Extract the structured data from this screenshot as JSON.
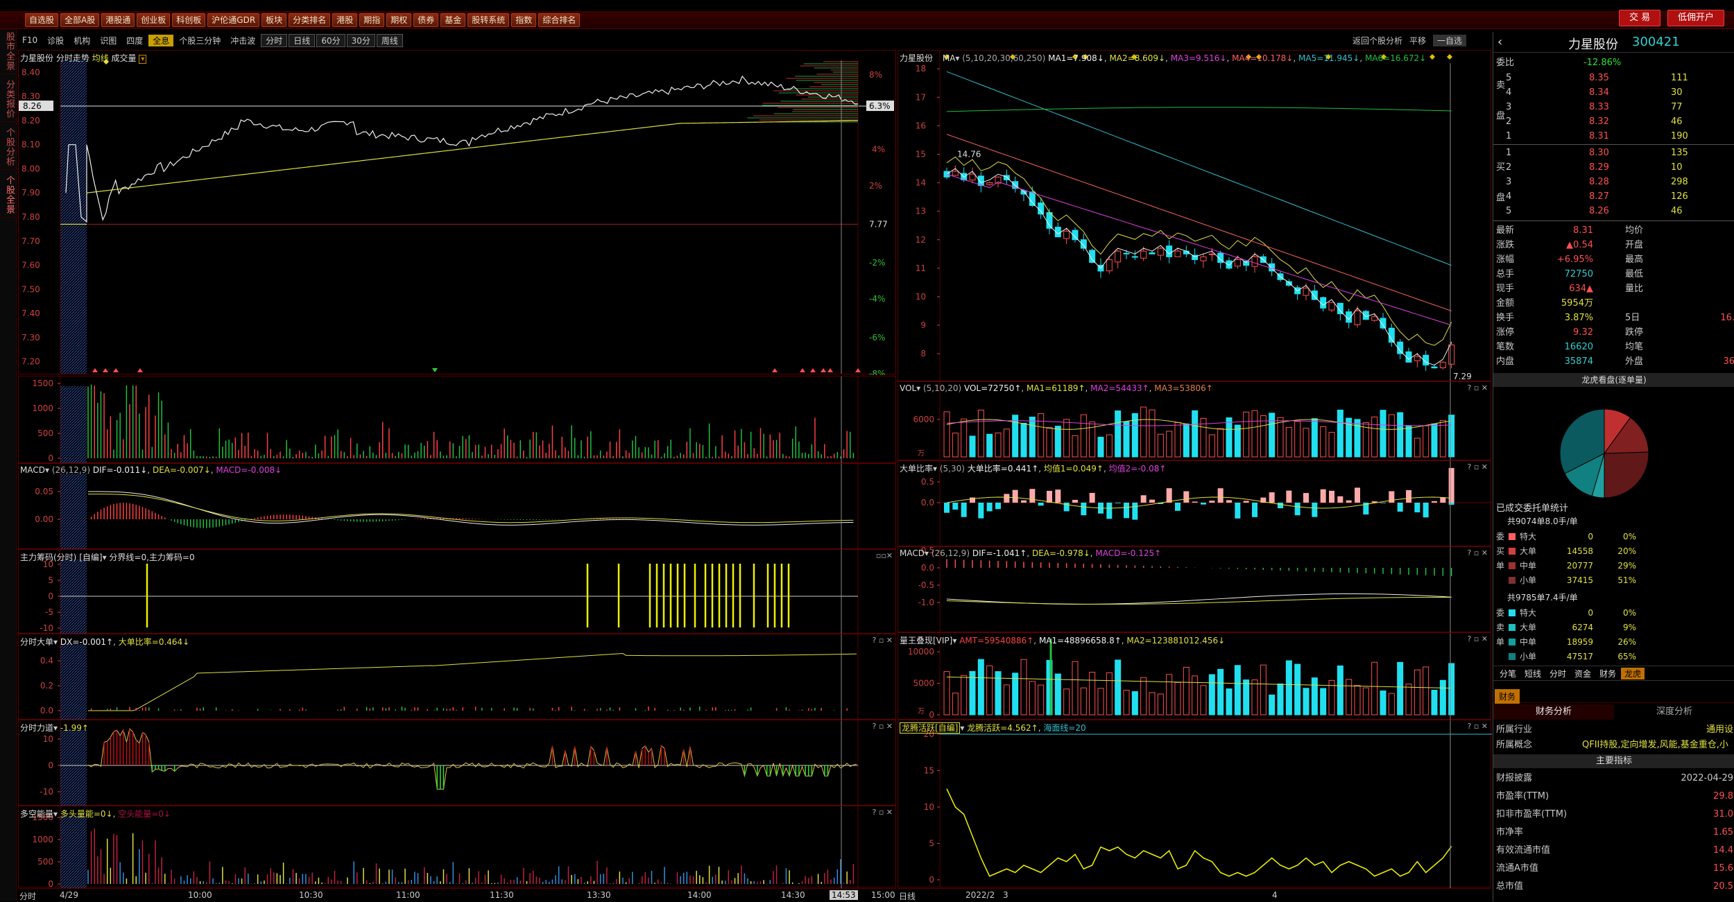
{
  "topbar": {
    "text": ""
  },
  "toolbar": {
    "items": [
      "自选股",
      "全部A股",
      "港股通",
      "创业板",
      "科创板",
      "沪伦通GDR",
      "板块",
      "分类排名",
      "港股",
      "期指",
      "期权",
      "债券",
      "基金",
      "股转系统",
      "指数",
      "综合排名"
    ],
    "trade": "交 易",
    "margin": "低佣开户"
  },
  "vtabs": [
    "股市全景",
    "分类报价",
    "个股分析",
    "个股全景"
  ],
  "subbar": {
    "items": [
      "F10",
      "诊股",
      "机构",
      "识图",
      "四度",
      "全息",
      "个股三分钟",
      "冲击波",
      "分时",
      "日线",
      "60分",
      "30分",
      "周线"
    ],
    "active": "全息",
    "right": [
      "返回个股分析",
      "平移",
      "一自选"
    ]
  },
  "intraday": {
    "title": "力星股份",
    "title2": "分时走势",
    "title3": "均线",
    "title4": "成交量",
    "y_left": [
      "8.40",
      "8.30",
      "8.26",
      "8.20",
      "8.10",
      "8.00",
      "7.90",
      "7.80",
      "7.70",
      "7.60",
      "7.50",
      "7.40",
      "7.30",
      "7.20"
    ],
    "y_right": [
      "8%",
      "6.3%",
      "4%",
      "2%",
      "7.77",
      "-2%",
      "-4%",
      "-6%",
      "-8%"
    ],
    "prev_close": 7.77,
    "current": 8.26,
    "times": [
      "4/29",
      "10:00",
      "10:30",
      "11:00",
      "11:30",
      "13:30",
      "14:00",
      "14:30",
      "14:53",
      "15:00"
    ],
    "bottom_label": "分时"
  },
  "vol_panel": {
    "y": [
      "1500",
      "1000",
      "500",
      "0"
    ]
  },
  "macd_panel": {
    "name": "MACD",
    "params": "(26,12,9)",
    "dif": "DIF=-0.011↓",
    "dea": "DEA=-0.007↓",
    "macd": "MACD=-0.008↓",
    "y": [
      "0.05",
      "0.00"
    ]
  },
  "zl_panel": {
    "name": "主力筹码(分时)",
    "mode": "[自编]",
    "text": "分界线=0,主力筹码=0",
    "y": [
      "10",
      "5",
      "0",
      "-5",
      "-10"
    ]
  },
  "dd_panel": {
    "name": "分时大单",
    "dx": "DX=-0.001↑",
    "ratio": "大单比率=0.464↓",
    "y": [
      "0.4",
      "0.2",
      "0.0"
    ]
  },
  "ld_panel": {
    "name": "分时力道",
    "val": "-1.99↑",
    "y": [
      "10",
      "0",
      "-10"
    ]
  },
  "dk_panel": {
    "name": "多空能量",
    "bull": "多头量能=0↓",
    "bear": "空头能量=0↓",
    "y": [
      "1500",
      "1000",
      "500",
      "0"
    ]
  },
  "kline": {
    "title": "力星股份",
    "ma_label": "MA",
    "params": "(5,10,20,30,60,250)",
    "ma": [
      "MA1=7.908↓",
      "MA2=8.609↓",
      "MA3=9.516↓",
      "MA4=10.178↓",
      "MA5=11.945↓",
      "MA6=16.672↓"
    ],
    "y": [
      "18",
      "17",
      "16",
      "15",
      "14",
      "13",
      "12",
      "11",
      "10",
      "9",
      "8"
    ],
    "hi_label": "14.76",
    "lo_label": "7.29",
    "x_labels": [
      "2022/2",
      "3",
      "4"
    ],
    "bottom_label": "日线",
    "chart_data": {
      "type": "candlestick",
      "ylim": [
        7.2,
        18.2
      ],
      "closes": [
        14.2,
        14.4,
        14.1,
        14.3,
        13.9,
        14.0,
        14.2,
        14.1,
        13.8,
        13.6,
        13.2,
        12.9,
        12.4,
        12.1,
        12.3,
        12.0,
        11.7,
        11.2,
        10.9,
        11.3,
        11.6,
        11.5,
        11.4,
        11.6,
        11.5,
        11.7,
        11.4,
        11.6,
        11.5,
        11.3,
        11.4,
        11.5,
        11.2,
        11.0,
        11.3,
        11.1,
        11.4,
        11.2,
        10.9,
        10.6,
        10.4,
        10.1,
        10.3,
        9.9,
        9.6,
        9.8,
        9.4,
        9.1,
        9.5,
        9.2,
        9.3,
        8.9,
        8.4,
        8.0,
        7.7,
        7.9,
        7.6,
        7.5,
        7.7,
        8.31
      ]
    }
  },
  "vol_k": {
    "name": "VOL",
    "params": "(5,10,20)",
    "vol": "VOL=72750↑",
    "ma1": "MA1=61189↑",
    "ma2": "MA2=54433↑",
    "ma3": "MA3=53806↑",
    "y": [
      "6000"
    ],
    "unit": "万"
  },
  "ddbl": {
    "name": "大单比率",
    "params": "(5,30)",
    "val": "大单比率=0.441↑",
    "j1": "均值1=0.049↑",
    "j2": "均值2=-0.08↑",
    "y": [
      "0.5",
      "0.0"
    ]
  },
  "macd_k": {
    "name": "MACD",
    "params": "(26,12,9)",
    "dif": "DIF=-1.041↑",
    "dea": "DEA=-0.978↓",
    "macd": "MACD=-0.125↑",
    "y": [
      "0.5",
      "0.0",
      "-0.5",
      "-1.0"
    ]
  },
  "lzd": {
    "name": "量王叠现[VIP]",
    "amt": "AMT=59540886↑",
    "ma1": "MA1=48896658.8↑",
    "ma2": "MA2=123881012.456↓",
    "y": [
      "10000",
      "5000",
      "0"
    ],
    "unit": "万"
  },
  "lthy": {
    "name": "龙腾活跃[自编]",
    "val": "龙腾活跃=4.562↑",
    "sea": "海面线=20",
    "y": [
      "20",
      "15",
      "10",
      "5",
      "0"
    ]
  },
  "right": {
    "name": "力星股份",
    "code": "300421",
    "weibi_label": "委比",
    "weibi": "-12.86%",
    "asks": [
      [
        "5",
        "8.35",
        "111"
      ],
      [
        "4",
        "8.34",
        "30"
      ],
      [
        "3",
        "8.33",
        "77"
      ],
      [
        "2",
        "8.32",
        "46"
      ],
      [
        "1",
        "8.31",
        "190"
      ]
    ],
    "bids": [
      [
        "1",
        "8.30",
        "135"
      ],
      [
        "2",
        "8.29",
        "10"
      ],
      [
        "3",
        "8.28",
        "298"
      ],
      [
        "4",
        "8.27",
        "126"
      ],
      [
        "5",
        "8.26",
        "46"
      ]
    ],
    "sell_side": "卖盘",
    "buy_side": "买盘",
    "quote": [
      [
        "最新",
        "8.31",
        "均价",
        ""
      ],
      [
        "涨跌",
        "▲0.54",
        "开盘",
        ""
      ],
      [
        "涨幅",
        "+6.95%",
        "最高",
        ""
      ],
      [
        "总手",
        "72750",
        "最低",
        ""
      ],
      [
        "现手",
        "634▲",
        "量比",
        ""
      ],
      [
        "金额",
        "5954万",
        "",
        ""
      ],
      [
        "换手",
        "3.87%",
        "5日",
        "16."
      ],
      [
        "涨停",
        "9.32",
        "跌停",
        ""
      ],
      [
        "笔数",
        "16620",
        "均笔",
        ""
      ],
      [
        "内盘",
        "35874",
        "外盘",
        "36"
      ]
    ],
    "lh_title": "龙虎看盘(逐单量)",
    "deal_label": "已成交委托单统计",
    "buy_total": "共9074单8.0手/单",
    "sell_total": "共9785单7.4手/单",
    "buy_rows": [
      [
        "特大",
        "0",
        "0%"
      ],
      [
        "大单",
        "14558",
        "20%"
      ],
      [
        "中单",
        "20777",
        "29%"
      ],
      [
        "小单",
        "37415",
        "51%"
      ]
    ],
    "sell_rows": [
      [
        "特大",
        "0",
        "0%"
      ],
      [
        "大单",
        "6274",
        "9%"
      ],
      [
        "中单",
        "18959",
        "26%"
      ],
      [
        "小单",
        "47517",
        "65%"
      ]
    ],
    "buy_side_labels": [
      "委",
      "买",
      "单"
    ],
    "sell_side_labels": [
      "委",
      "卖",
      "单"
    ],
    "pie_data": {
      "type": "pie",
      "values": [
        20,
        29,
        51,
        9,
        26,
        65
      ]
    },
    "tabs": [
      "分笔",
      "短线",
      "分时",
      "资金",
      "财务",
      "龙虎"
    ],
    "active_tab": "龙虎",
    "fin_tab": "财务",
    "fin_a": "财务分析",
    "fin_b": "深度分析",
    "industry_label": "所属行业",
    "industry": "通用设",
    "concept_label": "所属概念",
    "concept": "QFII持股,定向增发,风能,基金重仓,小",
    "main_idx": "主要指标",
    "fin_rows": [
      [
        "财报披露",
        "2022-04-29"
      ],
      [
        "市盈率(TTM)",
        "29.8"
      ],
      [
        "扣非市盈率(TTM)",
        "31.0"
      ],
      [
        "市净率",
        "1.65"
      ],
      [
        "有效流通市值",
        "14.4"
      ],
      [
        "流通A市值",
        "15.6"
      ],
      [
        "总市值",
        "20.5"
      ]
    ]
  },
  "colors": {
    "up": "#ff4040",
    "down": "#00e0e0",
    "grid": "#5a0000",
    "yellow": "#e0e040",
    "white": "#e8e8e8",
    "magenta": "#e040e0"
  }
}
